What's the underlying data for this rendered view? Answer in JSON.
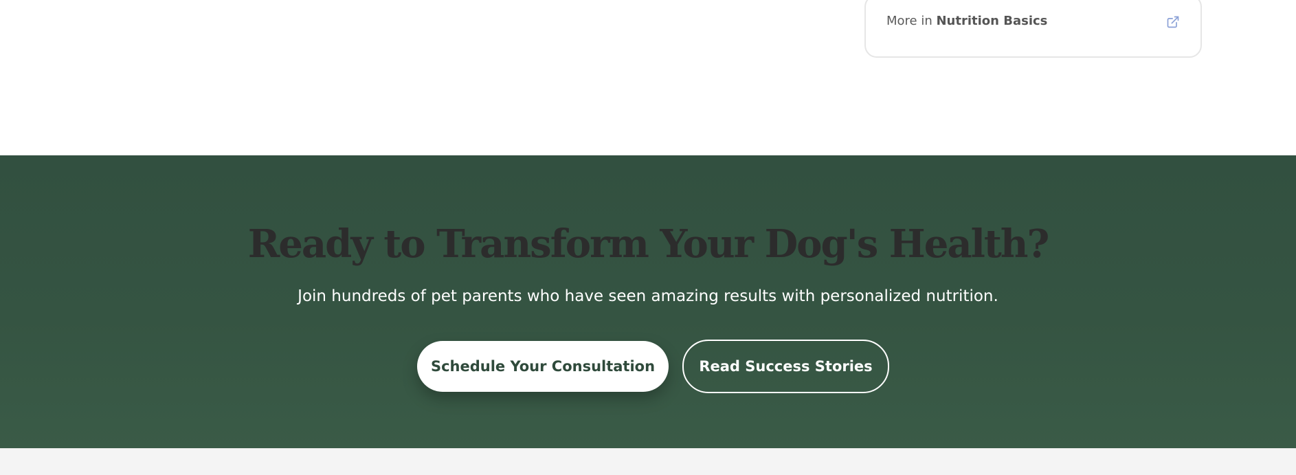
{
  "related": {
    "prefix": "More in ",
    "category": "Nutrition Basics",
    "icon": "external-link-icon"
  },
  "cta": {
    "title": "Ready to Transform Your Dog's Health?",
    "subtitle": "Join hundreds of pet parents who have seen amazing results with personalized nutrition.",
    "primary_button": "Schedule Your Consultation",
    "secondary_button": "Read Success Stories"
  },
  "colors": {
    "cta_background": "#345241",
    "title_text": "#2c2c2c",
    "primary_button_text": "#2f4a3b",
    "link_icon": "#8aa0d6"
  }
}
